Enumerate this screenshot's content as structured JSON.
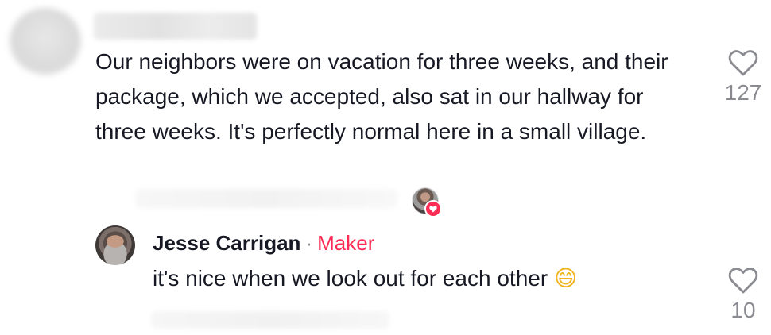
{
  "comment": {
    "text": "Our neighbors were on vacation for three weeks, and their package, which we accepted, also sat in our hallway for three weeks. It's perfectly normal here in a small village.",
    "likes": "127"
  },
  "reply": {
    "author": "Jesse Carrigan",
    "separator": "·",
    "role": "Maker",
    "text": "it's nice when we look out for each other",
    "emoji": "😄",
    "likes": "10"
  },
  "colors": {
    "accent": "#fe2c55",
    "muted": "#8a8b91",
    "text": "#161823"
  },
  "icons": {
    "like": "heart-outline-icon",
    "creator_liked": "heart-badge-icon"
  }
}
